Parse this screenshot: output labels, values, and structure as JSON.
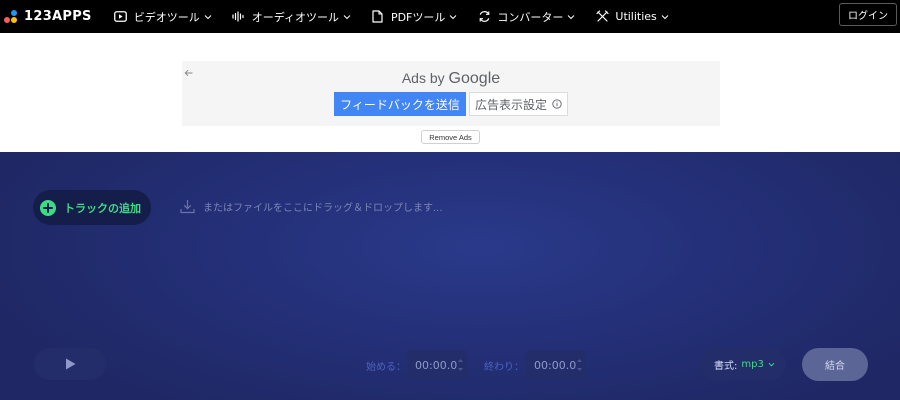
{
  "brand": {
    "logo_text": "123APPS"
  },
  "nav": {
    "items": [
      {
        "label": "ビデオツール",
        "icon": "video-icon"
      },
      {
        "label": "オーディオツール",
        "icon": "waveform-icon"
      },
      {
        "label": "PDFツール",
        "icon": "document-icon"
      },
      {
        "label": "コンバーター",
        "icon": "convert-icon"
      },
      {
        "label": "Utilities",
        "icon": "tools-icon"
      }
    ],
    "login_label": "ログイン"
  },
  "ad": {
    "ads_by_prefix": "Ads by ",
    "ads_by_brand": "Google",
    "feedback_label": "フィードバックを送信",
    "settings_label": "広告表示設定",
    "remove_ads_label": "Remove Ads"
  },
  "editor": {
    "add_track_label": "トラックの追加",
    "drop_hint": "またはファイルをここにドラッグ＆ドロップします...",
    "start_label": "始める：",
    "start_value": "00:00.0",
    "end_label": "終わり：",
    "end_value": "00:00.0",
    "format_label": "書式:",
    "format_value": "mp3",
    "merge_label": "結合"
  },
  "colors": {
    "topbar_bg": "#000000",
    "accent_green": "#3ddc84",
    "google_blue": "#4285f4",
    "editor_bg": "#1f2864"
  }
}
